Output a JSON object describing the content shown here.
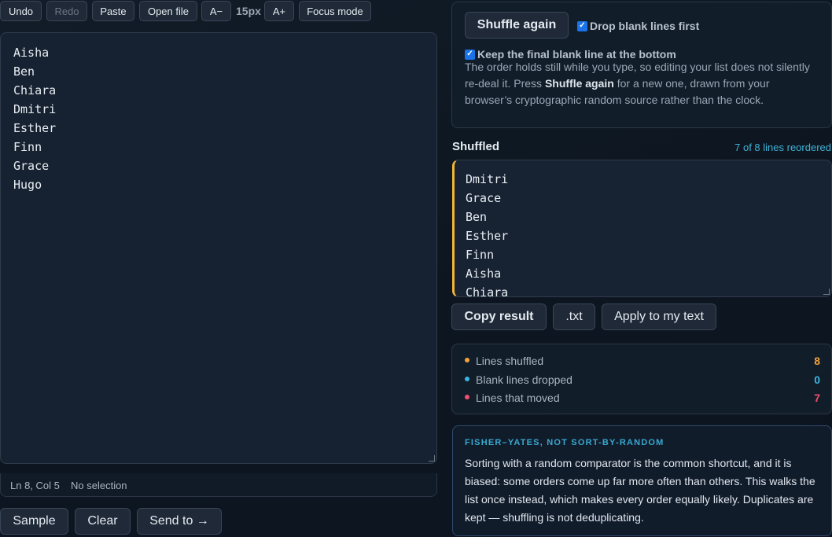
{
  "toolbar": {
    "undo": "Undo",
    "redo": "Redo",
    "paste": "Paste",
    "open_file": "Open file",
    "font_decrease": "A−",
    "font_size": "15px",
    "font_increase": "A+",
    "focus_mode": "Focus mode"
  },
  "input_lines": [
    "Aisha",
    "Ben",
    "Chiara",
    "Dmitri",
    "Esther",
    "Finn",
    "Grace",
    "Hugo"
  ],
  "status": {
    "cursor": "Ln 8, Col 5",
    "selection": "No selection"
  },
  "bottom_actions": {
    "sample": "Sample",
    "clear": "Clear",
    "send_to": "Send to →"
  },
  "options": {
    "shuffle_again": "Shuffle again",
    "drop_blank_label": "Drop blank lines first",
    "drop_blank_checked": true,
    "keep_final_label": "Keep the final blank line at the bottom",
    "keep_final_checked": true,
    "note_part1": "The order holds still while you type, so editing your list does not silently re-deal it. Press ",
    "note_bold": "Shuffle again",
    "note_part2": " for a new one, drawn from your browser’s cryptographic random source rather than the clock."
  },
  "result": {
    "title": "Shuffled",
    "meta": "7 of 8 lines reordered",
    "lines": [
      "Dmitri",
      "Grace",
      "Ben",
      "Esther",
      "Finn",
      "Aisha",
      "Chiara"
    ],
    "copy": "Copy result",
    "txt": ".txt",
    "apply": "Apply to my text"
  },
  "stats": [
    {
      "label": "Lines shuffled",
      "value": "8",
      "color": "#f2a33a"
    },
    {
      "label": "Blank lines dropped",
      "value": "0",
      "color": "#3bb6e0"
    },
    {
      "label": "Lines that moved",
      "value": "7",
      "color": "#f0506e"
    }
  ],
  "info": {
    "title": "FISHER–YATES, NOT SORT-BY-RANDOM",
    "body": "Sorting with a random comparator is the common shortcut, and it is biased: some orders come up far more often than others. This walks the list once instead, which makes every order equally likely. Duplicates are kept — shuffling is not deduplicating."
  },
  "colors": {
    "accent_yellow": "#f2b632",
    "accent_cyan": "#3fb3d6",
    "checkbox": "#1a73e8"
  }
}
